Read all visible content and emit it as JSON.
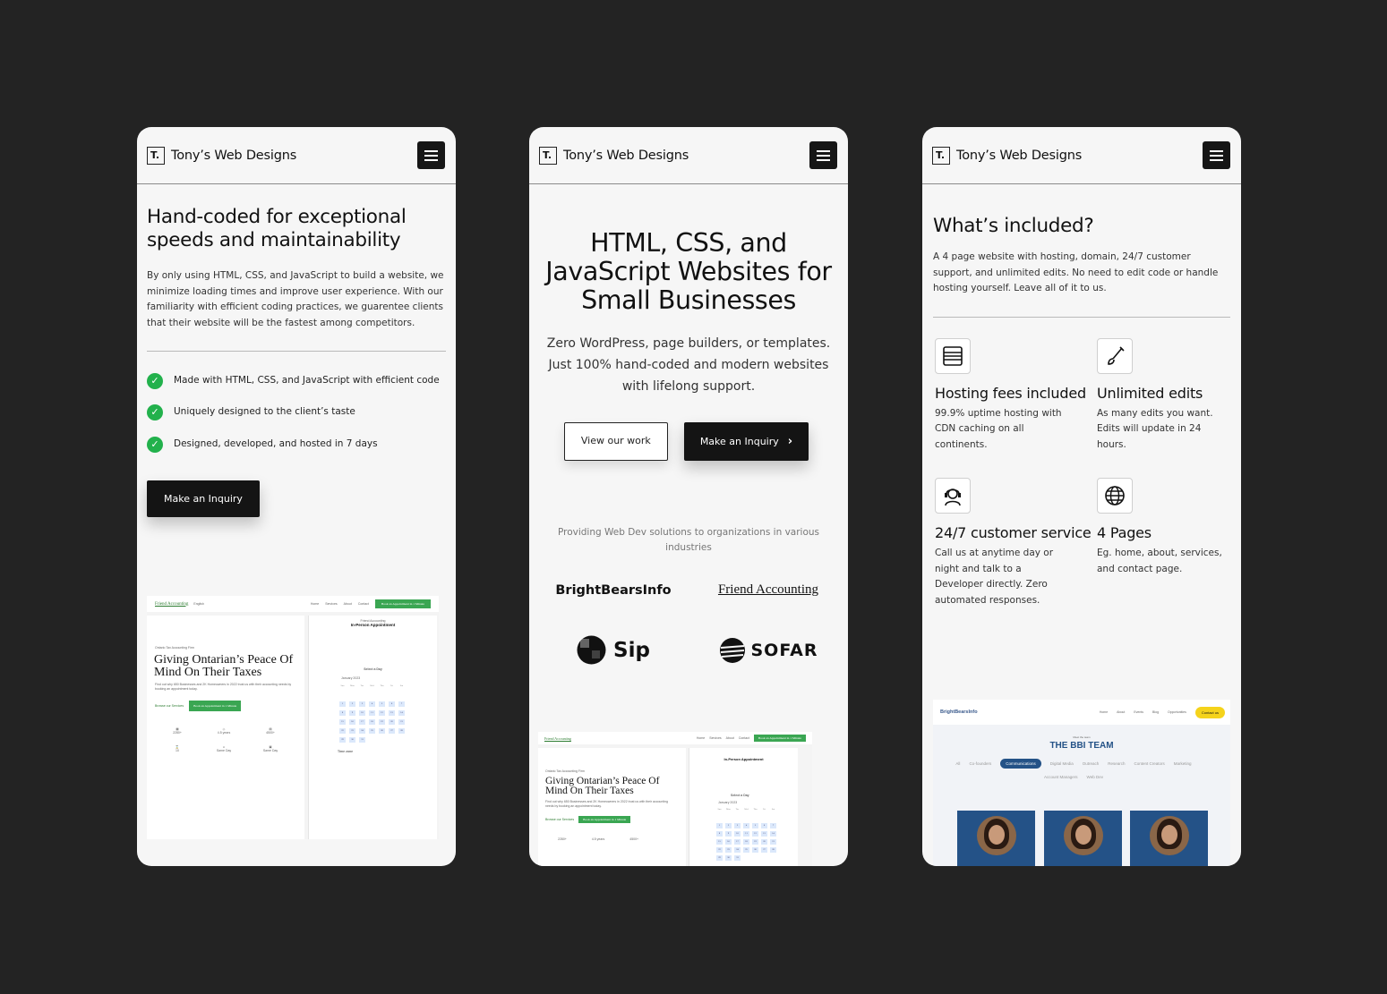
{
  "brand": {
    "logo_letter": "T.",
    "name": "Tony’s Web Designs"
  },
  "p1": {
    "heading": "Hand-coded for exceptional speeds and maintainability",
    "body": "By only using HTML, CSS, and JavaScript to build a website, we minimize loading times and improve user experience. With our familiarity with efficient coding practices, we guarentee clients that their website will be the fastest among competitors.",
    "checks": [
      "Made with HTML, CSS, and JavaScript with efficient code",
      "Uniquely designed to the client’s taste",
      "Designed, developed, and hosted in 7 days"
    ],
    "cta": "Make an Inquiry"
  },
  "p2": {
    "heading": "HTML, CSS, and JavaScript Websites for Small Businesses",
    "sub": "Zero WordPress, page builders, or templates. Just 100% hand-coded and modern websites with lifelong support.",
    "btn_work": "View our work",
    "btn_inquiry": "Make an Inquiry",
    "clients_caption": "Providing Web Dev solutions to organizations in various industries",
    "clients": [
      "BrightBearsInfo",
      "Friend Accounting",
      "Sip",
      "SOFAR"
    ]
  },
  "p3": {
    "heading": "What’s included?",
    "intro": "A 4 page website with hosting, domain, 24/7 customer support, and unlimited edits. No need to edit code or handle hosting yourself. Leave all of it to us.",
    "features": [
      {
        "icon": "server-icon",
        "title": "Hosting fees included",
        "desc": "99.9% uptime hosting with CDN caching on all continents."
      },
      {
        "icon": "brush-icon",
        "title": "Unlimited edits",
        "desc": "As many edits you want. Edits will update in 24 hours."
      },
      {
        "icon": "headset-icon",
        "title": "24/7 customer service",
        "desc": "Call us at anytime day or night and talk to a Developer directly. Zero automated responses."
      },
      {
        "icon": "globe-icon",
        "title": "4 Pages",
        "desc": "Eg. home, about, services, and contact page."
      }
    ]
  },
  "mock_fa": {
    "logo": "Friend Accounting",
    "lang": "English",
    "nav": [
      "Home",
      "Services",
      "About",
      "Contact"
    ],
    "book": "Book an Appointment in 1 Minute",
    "eyebrow": "Ontario Tax Accounting Firm",
    "title": "Giving Ontarian’s Peace Of Mind On Their Taxes",
    "blurb": "Find out why 650 Businesses and 2K Homeowners in 2022 trust us with their accounting needs by booking an appointment today.",
    "browse": "Browse our Services",
    "stats": [
      "2280+",
      "4.5 years",
      "4500+",
      "10",
      "Same Day",
      "Same Day"
    ],
    "panel_brand": "Friend Accounting",
    "panel_title": "In-Person Appointment",
    "select_day": "Select a Day",
    "month": "January 2023",
    "timezone": "Time zone",
    "days": [
      "Sun",
      "Mon",
      "Tue",
      "Wed",
      "Thu",
      "Fri",
      "Sat"
    ],
    "dates": [
      "",
      "",
      "",
      "",
      "",
      "",
      "",
      "1",
      "2",
      "3",
      "4",
      "5",
      "6",
      "7",
      "8",
      "9",
      "10",
      "11",
      "12",
      "13",
      "14",
      "15",
      "16",
      "17",
      "18",
      "19",
      "20",
      "21",
      "22",
      "23",
      "24",
      "25",
      "26",
      "27",
      "28",
      "29",
      "30",
      "31"
    ]
  },
  "mock_bbi": {
    "logo": "BrightBearsInfo",
    "nav": [
      "Home",
      "About",
      "Events",
      "Blog",
      "Opportunities"
    ],
    "contact": "Contact us",
    "eyebrow": "Meet the team",
    "title": "THE BBI TEAM",
    "tabs": [
      "All",
      "Co-founders",
      "Communications",
      "Digital Media",
      "Outreach",
      "Research",
      "Content Creators",
      "Marketing",
      "Account Managers",
      "Web Dev"
    ],
    "active_tab": "Communications"
  },
  "colors": {
    "green": "#22b14c",
    "dark": "#141414",
    "bbi_blue": "#245287",
    "bbi_yellow": "#f5d31b"
  }
}
